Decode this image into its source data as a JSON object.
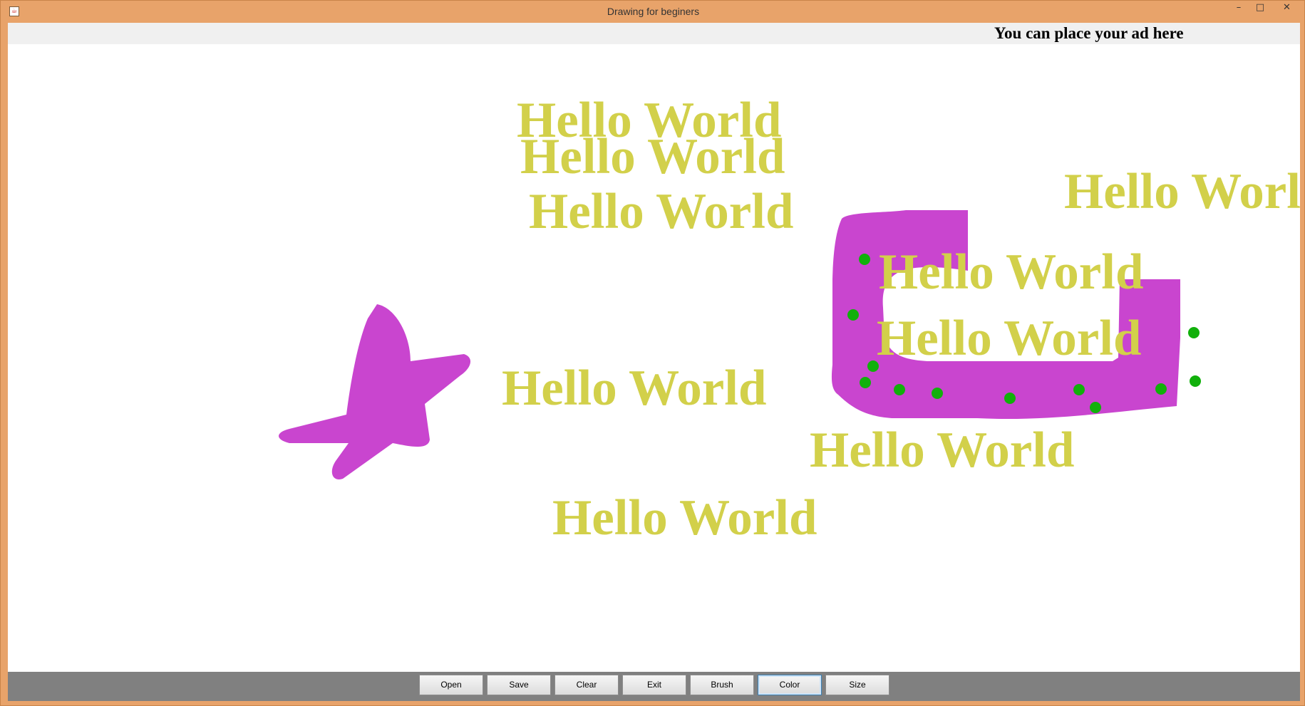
{
  "window": {
    "title": "Drawing for beginers",
    "controls": {
      "minimize": "–",
      "maximize": "□",
      "close": "✕"
    }
  },
  "ad_bar": {
    "text": "You can place your ad here"
  },
  "canvas": {
    "text_stamps": [
      "Hello World",
      "Hello World",
      "Hello World",
      "Hello World",
      "Hello World",
      "Hello World",
      "Hello World",
      "Hello World",
      "Hello World"
    ],
    "colors": {
      "text": "#d2d04a",
      "brush": "#c945cf",
      "dots": "#11b00b",
      "background": "#ffffff"
    }
  },
  "toolbar": {
    "buttons": [
      "Open",
      "Save",
      "Clear",
      "Exit",
      "Brush",
      "Color",
      "Size"
    ],
    "focused": "Color"
  },
  "icons": {
    "app": "java-cup-icon"
  }
}
